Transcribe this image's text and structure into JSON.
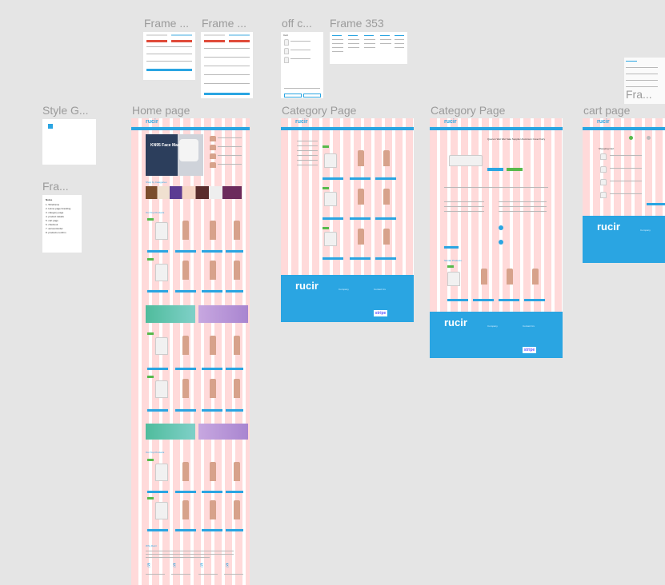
{
  "frames": {
    "frame1": {
      "label": "Frame ..."
    },
    "frame2": {
      "label": "Frame ..."
    },
    "offc": {
      "label": "off c..."
    },
    "frame353": {
      "label": "Frame 353"
    },
    "styleguide": {
      "label": "Style G..."
    },
    "fra": {
      "label": "Fra..."
    },
    "home": {
      "label": "Home page",
      "logo": "rucir",
      "banner_title": "KN95 Face Mask",
      "section_categories": "Shop by Categories",
      "section_top": "Our Top Products",
      "section_why": "Why Rucir"
    },
    "cat1": {
      "label": "Category Page",
      "logo": "rucir",
      "footer_logo": "rucir",
      "stripe": "stripe",
      "footer_col1": "Company",
      "footer_col2": "Contact Us"
    },
    "cat2": {
      "label": "Category Page",
      "logo": "rucir",
      "footer_logo": "rucir",
      "stripe": "stripe",
      "product_title": "Querum Wet Wet Sale Supplier Aluminum Cover Fairy",
      "footer_col1": "Company",
      "footer_col2": "Contact Us"
    },
    "cart": {
      "label": "cart page",
      "logo": "rucir",
      "footer_logo": "rucir",
      "footer_col": "Company",
      "fra_label": "Fra..."
    }
  },
  "notes": {
    "title": "Notes",
    "items": [
      "1. Wireframe",
      "2. Home page branding",
      "3. category page",
      "4. product details",
      "5. cart page",
      "6. checkout",
      "7. account/order",
      "8. products confirm"
    ]
  },
  "colors": {
    "accent": "#2aa5e2",
    "green": "#57b94a",
    "grid": "#ffc8c8"
  }
}
